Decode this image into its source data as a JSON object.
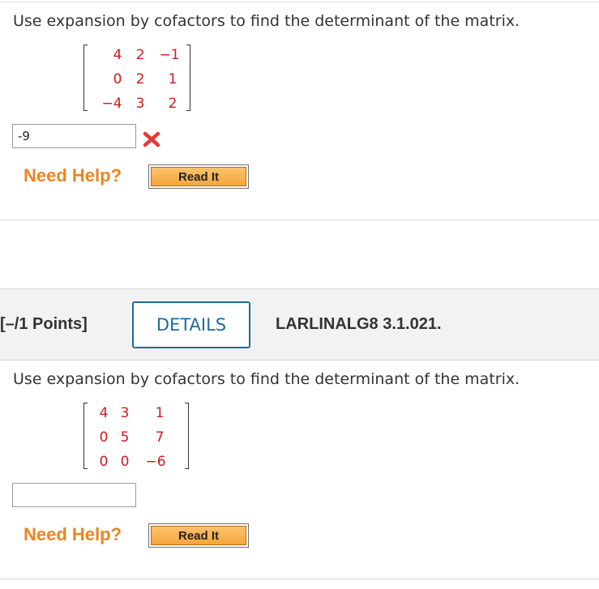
{
  "question1": {
    "prompt": "Use expansion by cofactors to find the determinant of the matrix.",
    "matrix": [
      [
        "4",
        "2",
        "−1"
      ],
      [
        "0",
        "2",
        "1"
      ],
      [
        "−4",
        "3",
        "2"
      ]
    ],
    "answer_value": "-9",
    "answer_status": "incorrect",
    "help_label": "Need Help?",
    "read_it_label": "Read It"
  },
  "question2_header": {
    "points": "[–/1 Points]",
    "details_label": "DETAILS",
    "problem_id": "LARLINALG8 3.1.021."
  },
  "question2": {
    "prompt": "Use expansion by cofactors to find the determinant of the matrix.",
    "matrix": [
      [
        "4",
        "3",
        "1"
      ],
      [
        "0",
        "5",
        "7"
      ],
      [
        "0",
        "0",
        "−6"
      ]
    ],
    "answer_value": "",
    "help_label": "Need Help?",
    "read_it_label": "Read It"
  },
  "colors": {
    "matrix_entry": "#d11a1a",
    "need_help": "#f0831e",
    "details_accent": "#1e6b9e",
    "incorrect_mark": "#e03a3a",
    "read_it_button": "#f5a63a"
  },
  "icons": {
    "incorrect": "x-mark-icon"
  }
}
